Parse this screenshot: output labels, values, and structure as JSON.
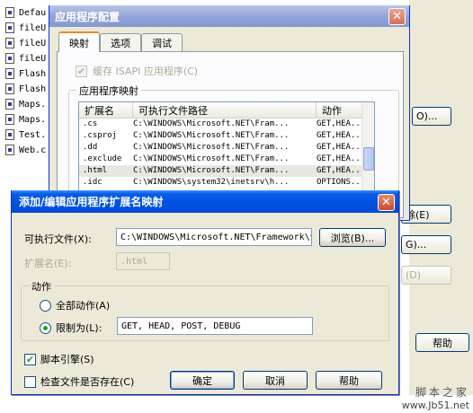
{
  "background_files": [
    "Defau",
    "fileU",
    "fileU",
    "fileU",
    "Flash",
    "Flash",
    "Maps.",
    "Maps.",
    "Test.",
    "Web.c"
  ],
  "parent_buttons": {
    "edit": "O)...",
    "delete": "除(E)",
    "g": "G)...",
    "d": "(D)",
    "help": "帮助"
  },
  "config_window": {
    "title": "应用程序配置",
    "tabs": [
      "映射",
      "选项",
      "调试"
    ],
    "cache_label": "缓存 ISAPI 应用程序(C)",
    "mapping_group": "应用程序映射",
    "columns": [
      "扩展名",
      "可执行文件路径",
      "动作"
    ],
    "rows": [
      {
        "ext": ".cs",
        "path": "C:\\WINDOWS\\Microsoft.NET\\Fram...",
        "verbs": "GET,HEA..."
      },
      {
        "ext": ".csproj",
        "path": "C:\\WINDOWS\\Microsoft.NET\\Fram...",
        "verbs": "GET,HEA..."
      },
      {
        "ext": ".dd",
        "path": "C:\\WINDOWS\\Microsoft.NET\\Fram...",
        "verbs": "GET,HEA..."
      },
      {
        "ext": ".exclude",
        "path": "C:\\WINDOWS\\Microsoft.NET\\Fram...",
        "verbs": "GET,HEA..."
      },
      {
        "ext": ".html",
        "path": "C:\\WINDOWS\\Microsoft.NET\\Fram...",
        "verbs": "GET,HEA..."
      },
      {
        "ext": ".idc",
        "path": "C:\\WINDOWS\\system32\\inetsrv\\h...",
        "verbs": "OPTIONS..."
      }
    ]
  },
  "edit_dialog": {
    "title": "添加/编辑应用程序扩展名映射",
    "exe_label": "可执行文件(X):",
    "exe_value": "C:\\WINDOWS\\Microsoft.NET\\Framework\\v",
    "browse": "浏览(B)...",
    "ext_label": "扩展名(E):",
    "ext_value": ".html",
    "action_group": "动作",
    "all_verbs": "全部动作(A)",
    "limit_to": "限制为(L):",
    "limit_value": "GET, HEAD, POST, DEBUG",
    "script_engine": "脚本引擎(S)",
    "check_file": "检查文件是否存在(C)",
    "ok": "确定",
    "cancel": "取消",
    "help": "帮助"
  },
  "watermark": {
    "text": "脚本之家",
    "url": "www.Jb51.net"
  }
}
